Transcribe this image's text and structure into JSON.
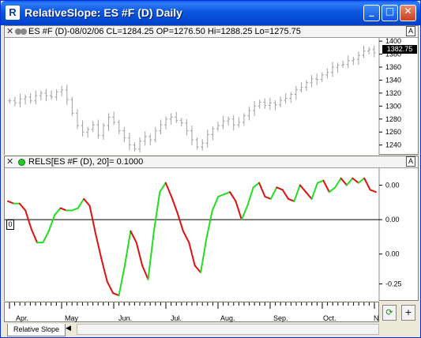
{
  "window": {
    "title": "RelativeSlope: ES #F (D) Daily"
  },
  "titlebar_buttons": {
    "minimize": "_",
    "maximize": "□",
    "close": "✕"
  },
  "price_pane": {
    "close_glyph": "✕",
    "header": "ES #F (D)-08/02/06 CL=1284.25 OP=1276.50 Hi=1288.25 Lo=1275.75",
    "axis_button": "A",
    "last_price": "1382.75",
    "y_labels": [
      "1400",
      "1380",
      "1360",
      "1340",
      "1320",
      "1300",
      "1280",
      "1260",
      "1240"
    ],
    "y_values": [
      1400,
      1380,
      1360,
      1340,
      1320,
      1300,
      1280,
      1260,
      1240
    ],
    "bar_color": "#a0a0a0",
    "closes": [
      1308,
      1305,
      1311,
      1314,
      1308,
      1316,
      1320,
      1316,
      1314,
      1322,
      1325,
      1310,
      1289,
      1270,
      1260,
      1264,
      1271,
      1255,
      1270,
      1283,
      1275,
      1262,
      1251,
      1240,
      1234,
      1246,
      1253,
      1248,
      1262,
      1271,
      1280,
      1283,
      1278,
      1274,
      1262,
      1248,
      1237,
      1243,
      1256,
      1265,
      1270,
      1277,
      1280,
      1271,
      1275,
      1285,
      1293,
      1300,
      1306,
      1301,
      1305,
      1302,
      1309,
      1312,
      1318,
      1325,
      1329,
      1336,
      1342,
      1341,
      1348,
      1352,
      1360,
      1363,
      1364,
      1370,
      1372,
      1378,
      1385,
      1387,
      1382
    ]
  },
  "indicator_pane": {
    "close_glyph": "✕",
    "header": "RELS[ES #F (D), 20]=  0.1000",
    "axis_button": "A",
    "zero_marker": "0",
    "y_labels": [
      "0.00",
      "0.00",
      "0.00",
      "-0.25"
    ],
    "y_values": [
      0.15,
      0.0,
      -0.15,
      -0.28
    ],
    "up_color": "#22dd22",
    "down_color": "#dd1111",
    "values": [
      0.08,
      0.07,
      0.07,
      0.04,
      -0.04,
      -0.1,
      -0.1,
      -0.05,
      0.02,
      0.05,
      0.04,
      0.04,
      0.05,
      0.09,
      0.06,
      -0.06,
      -0.17,
      -0.27,
      -0.32,
      -0.33,
      -0.2,
      -0.05,
      -0.1,
      -0.2,
      -0.26,
      -0.05,
      0.12,
      0.16,
      0.1,
      0.03,
      -0.05,
      -0.1,
      -0.2,
      -0.23,
      -0.08,
      0.04,
      0.1,
      0.11,
      0.12,
      0.08,
      0.0,
      0.06,
      0.14,
      0.16,
      0.1,
      0.09,
      0.14,
      0.13,
      0.09,
      0.08,
      0.15,
      0.12,
      0.09,
      0.16,
      0.17,
      0.12,
      0.14,
      0.18,
      0.15,
      0.18,
      0.16,
      0.18,
      0.13,
      0.12
    ]
  },
  "x_axis": {
    "labels": [
      "Apr.",
      "May",
      "Jun.",
      "Jul.",
      "Aug.",
      "Sep.",
      "Oct.",
      "N"
    ]
  },
  "tabs": {
    "active": "Relative Slope",
    "scroll_left": "◀"
  },
  "controls": {
    "refresh_glyph": "⟳",
    "plus_glyph": "+"
  }
}
